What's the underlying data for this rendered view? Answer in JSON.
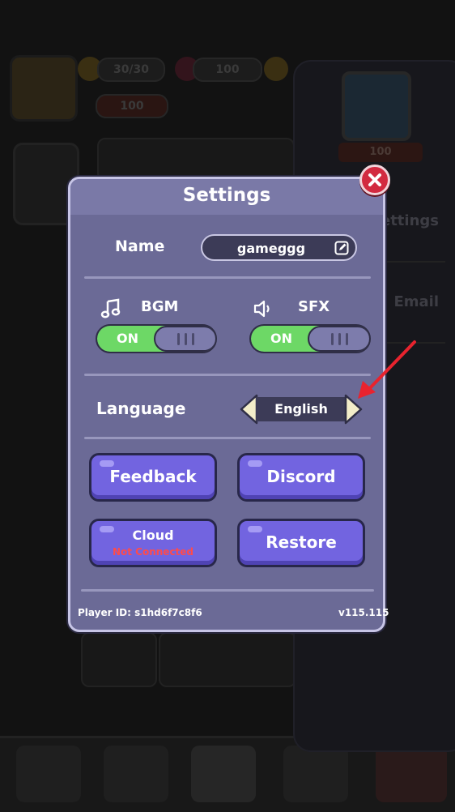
{
  "background": {
    "energy": "30/30",
    "gems": "100",
    "level_bar": "100",
    "profile_level": "100",
    "right_panel_items": [
      "Settings",
      "Email"
    ]
  },
  "settings": {
    "title": "Settings",
    "name_label": "Name",
    "name_value": "gameggg",
    "bgm_label": "BGM",
    "bgm_state": "ON",
    "sfx_label": "SFX",
    "sfx_state": "ON",
    "language_label": "Language",
    "language_value": "English",
    "buttons": {
      "feedback": "Feedback",
      "discord": "Discord",
      "cloud": "Cloud",
      "cloud_status": "Not Connected",
      "restore": "Restore"
    },
    "player_id": "Player ID: s1hd6f7c8f6",
    "version": "v115.115"
  },
  "colors": {
    "modal_bg": "#6b6a96",
    "toggle_on": "#6dd866",
    "button": "#7264e0",
    "close": "#d22a40",
    "warning_text": "#ff4b4b",
    "annotation_arrow": "#e8232e"
  }
}
